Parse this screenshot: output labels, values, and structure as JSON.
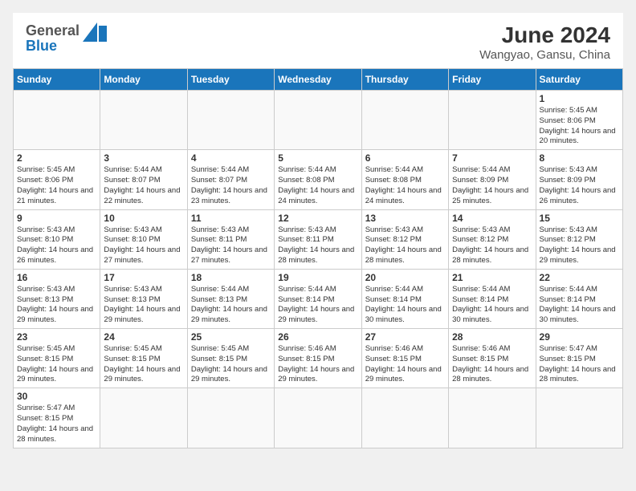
{
  "header": {
    "logo_general": "General",
    "logo_blue": "Blue",
    "title": "June 2024",
    "location": "Wangyao, Gansu, China"
  },
  "days": [
    "Sunday",
    "Monday",
    "Tuesday",
    "Wednesday",
    "Thursday",
    "Friday",
    "Saturday"
  ],
  "weeks": [
    [
      {
        "day": "",
        "info": ""
      },
      {
        "day": "",
        "info": ""
      },
      {
        "day": "",
        "info": ""
      },
      {
        "day": "",
        "info": ""
      },
      {
        "day": "",
        "info": ""
      },
      {
        "day": "",
        "info": ""
      },
      {
        "day": "1",
        "info": "Sunrise: 5:45 AM\nSunset: 8:06 PM\nDaylight: 14 hours and 20 minutes."
      }
    ],
    [
      {
        "day": "2",
        "info": "Sunrise: 5:45 AM\nSunset: 8:06 PM\nDaylight: 14 hours and 21 minutes."
      },
      {
        "day": "3",
        "info": "Sunrise: 5:44 AM\nSunset: 8:07 PM\nDaylight: 14 hours and 22 minutes."
      },
      {
        "day": "4",
        "info": "Sunrise: 5:44 AM\nSunset: 8:07 PM\nDaylight: 14 hours and 23 minutes."
      },
      {
        "day": "5",
        "info": "Sunrise: 5:44 AM\nSunset: 8:08 PM\nDaylight: 14 hours and 24 minutes."
      },
      {
        "day": "6",
        "info": "Sunrise: 5:44 AM\nSunset: 8:08 PM\nDaylight: 14 hours and 24 minutes."
      },
      {
        "day": "7",
        "info": "Sunrise: 5:44 AM\nSunset: 8:09 PM\nDaylight: 14 hours and 25 minutes."
      },
      {
        "day": "8",
        "info": "Sunrise: 5:43 AM\nSunset: 8:09 PM\nDaylight: 14 hours and 26 minutes."
      }
    ],
    [
      {
        "day": "9",
        "info": "Sunrise: 5:43 AM\nSunset: 8:10 PM\nDaylight: 14 hours and 26 minutes."
      },
      {
        "day": "10",
        "info": "Sunrise: 5:43 AM\nSunset: 8:10 PM\nDaylight: 14 hours and 27 minutes."
      },
      {
        "day": "11",
        "info": "Sunrise: 5:43 AM\nSunset: 8:11 PM\nDaylight: 14 hours and 27 minutes."
      },
      {
        "day": "12",
        "info": "Sunrise: 5:43 AM\nSunset: 8:11 PM\nDaylight: 14 hours and 28 minutes."
      },
      {
        "day": "13",
        "info": "Sunrise: 5:43 AM\nSunset: 8:12 PM\nDaylight: 14 hours and 28 minutes."
      },
      {
        "day": "14",
        "info": "Sunrise: 5:43 AM\nSunset: 8:12 PM\nDaylight: 14 hours and 28 minutes."
      },
      {
        "day": "15",
        "info": "Sunrise: 5:43 AM\nSunset: 8:12 PM\nDaylight: 14 hours and 29 minutes."
      }
    ],
    [
      {
        "day": "16",
        "info": "Sunrise: 5:43 AM\nSunset: 8:13 PM\nDaylight: 14 hours and 29 minutes."
      },
      {
        "day": "17",
        "info": "Sunrise: 5:43 AM\nSunset: 8:13 PM\nDaylight: 14 hours and 29 minutes."
      },
      {
        "day": "18",
        "info": "Sunrise: 5:44 AM\nSunset: 8:13 PM\nDaylight: 14 hours and 29 minutes."
      },
      {
        "day": "19",
        "info": "Sunrise: 5:44 AM\nSunset: 8:14 PM\nDaylight: 14 hours and 29 minutes."
      },
      {
        "day": "20",
        "info": "Sunrise: 5:44 AM\nSunset: 8:14 PM\nDaylight: 14 hours and 30 minutes."
      },
      {
        "day": "21",
        "info": "Sunrise: 5:44 AM\nSunset: 8:14 PM\nDaylight: 14 hours and 30 minutes."
      },
      {
        "day": "22",
        "info": "Sunrise: 5:44 AM\nSunset: 8:14 PM\nDaylight: 14 hours and 30 minutes."
      }
    ],
    [
      {
        "day": "23",
        "info": "Sunrise: 5:45 AM\nSunset: 8:15 PM\nDaylight: 14 hours and 29 minutes."
      },
      {
        "day": "24",
        "info": "Sunrise: 5:45 AM\nSunset: 8:15 PM\nDaylight: 14 hours and 29 minutes."
      },
      {
        "day": "25",
        "info": "Sunrise: 5:45 AM\nSunset: 8:15 PM\nDaylight: 14 hours and 29 minutes."
      },
      {
        "day": "26",
        "info": "Sunrise: 5:46 AM\nSunset: 8:15 PM\nDaylight: 14 hours and 29 minutes."
      },
      {
        "day": "27",
        "info": "Sunrise: 5:46 AM\nSunset: 8:15 PM\nDaylight: 14 hours and 29 minutes."
      },
      {
        "day": "28",
        "info": "Sunrise: 5:46 AM\nSunset: 8:15 PM\nDaylight: 14 hours and 28 minutes."
      },
      {
        "day": "29",
        "info": "Sunrise: 5:47 AM\nSunset: 8:15 PM\nDaylight: 14 hours and 28 minutes."
      }
    ],
    [
      {
        "day": "30",
        "info": "Sunrise: 5:47 AM\nSunset: 8:15 PM\nDaylight: 14 hours and 28 minutes."
      },
      {
        "day": "",
        "info": ""
      },
      {
        "day": "",
        "info": ""
      },
      {
        "day": "",
        "info": ""
      },
      {
        "day": "",
        "info": ""
      },
      {
        "day": "",
        "info": ""
      },
      {
        "day": "",
        "info": ""
      }
    ]
  ]
}
